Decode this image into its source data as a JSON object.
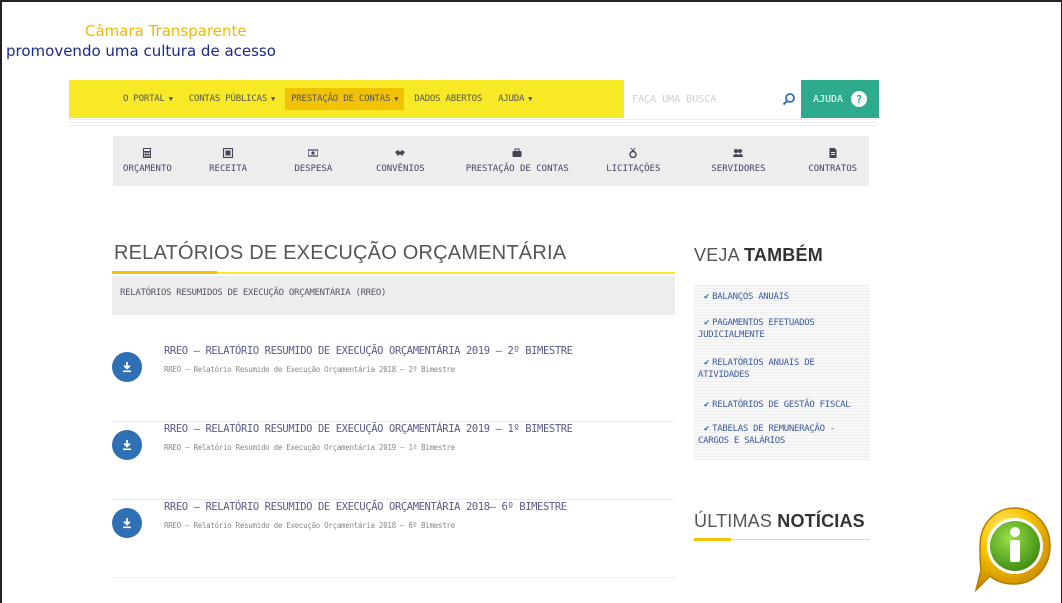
{
  "brand": {
    "title": "Câmara Transparente",
    "subtitle": "promovendo uma cultura de acesso"
  },
  "nav": {
    "items": [
      {
        "label": "O PORTAL",
        "caret": true,
        "active": false
      },
      {
        "label": "CONTAS PÚBLICAS",
        "caret": true,
        "active": false
      },
      {
        "label": "PRESTAÇÃO DE CONTAS",
        "caret": true,
        "active": true
      },
      {
        "label": "DADOS ABERTOS",
        "caret": false,
        "active": false
      },
      {
        "label": "AJUDA",
        "caret": true,
        "active": false
      }
    ],
    "search_placeholder": "FAÇA UMA BUSCA",
    "help_label": "AJUDA",
    "help_icon": "?"
  },
  "icon_tabs": [
    {
      "label": "ORÇAMENTO",
      "icon": "calculator-icon"
    },
    {
      "label": "RECEITA",
      "icon": "receipt-icon"
    },
    {
      "label": "DESPESA",
      "icon": "money-icon"
    },
    {
      "label": "CONVÊNIOS",
      "icon": "handshake-icon"
    },
    {
      "label": "PRESTAÇÃO DE CONTAS",
      "icon": "briefcase-icon"
    },
    {
      "label": "LICITAÇÕES",
      "icon": "medal-icon"
    },
    {
      "label": "SERVIDORES",
      "icon": "users-icon"
    },
    {
      "label": "CONTRATOS",
      "icon": "document-icon"
    }
  ],
  "main": {
    "title": "RELATÓRIOS DE EXECUÇÃO ORÇAMENTÁRIA",
    "section_label": "RELATÓRIOS RESUMIDOS DE EXECUÇÃO ORÇAMENTÁRIA (RREO)",
    "documents": [
      {
        "title": "RREO – RELATÓRIO RESUMIDO DE EXECUÇÃO ORÇAMENTÁRIA 2019 – 2º BIMESTRE",
        "subtitle": "RREO – Relatório Resumido de Execução Orçamentária 2018 – 2º Bimestre"
      },
      {
        "title": "RREO – RELATÓRIO RESUMIDO DE EXECUÇÃO ORÇAMENTÁRIA 2019 – 1º BIMESTRE",
        "subtitle": "RREO – Relatório Resumido de Execução Orçamentária 2019 – 1º Bimestre"
      },
      {
        "title": "RREO – RELATÓRIO RESUMIDO DE EXECUÇÃO ORÇAMENTÁRIA 2018– 6º BIMESTRE",
        "subtitle": "RREO – Relatório Resumido de Execução Orçamentária 2018 – 6º Bimestre"
      }
    ]
  },
  "sidebar": {
    "see_also_prefix": "VEJA",
    "see_also_bold": "TAMBÉM",
    "links": [
      [
        "BALANÇOS ANUAIS"
      ],
      [
        "PAGAMENTOS EFETUADOS",
        "JUDICIALMENTE"
      ],
      [
        "RELATÓRIOS ANUAIS DE",
        "ATIVIDADES"
      ],
      [
        "RELATÓRIOS DE GESTÃO FISCAL"
      ],
      [
        "TABELAS DE REMUNERAÇÃO -",
        "CARGOS E SALÁRIOS"
      ]
    ],
    "news_prefix": "ÚLTIMAS",
    "news_bold": "NOTÍCIAS"
  },
  "colors": {
    "nav_yellow": "#f7e925",
    "accent_gold": "#f2c305",
    "help_green": "#2eaa8c",
    "link_blue": "#2f6fb3",
    "brand_navy": "#1a2a8a",
    "brand_gold": "#f2b705"
  }
}
